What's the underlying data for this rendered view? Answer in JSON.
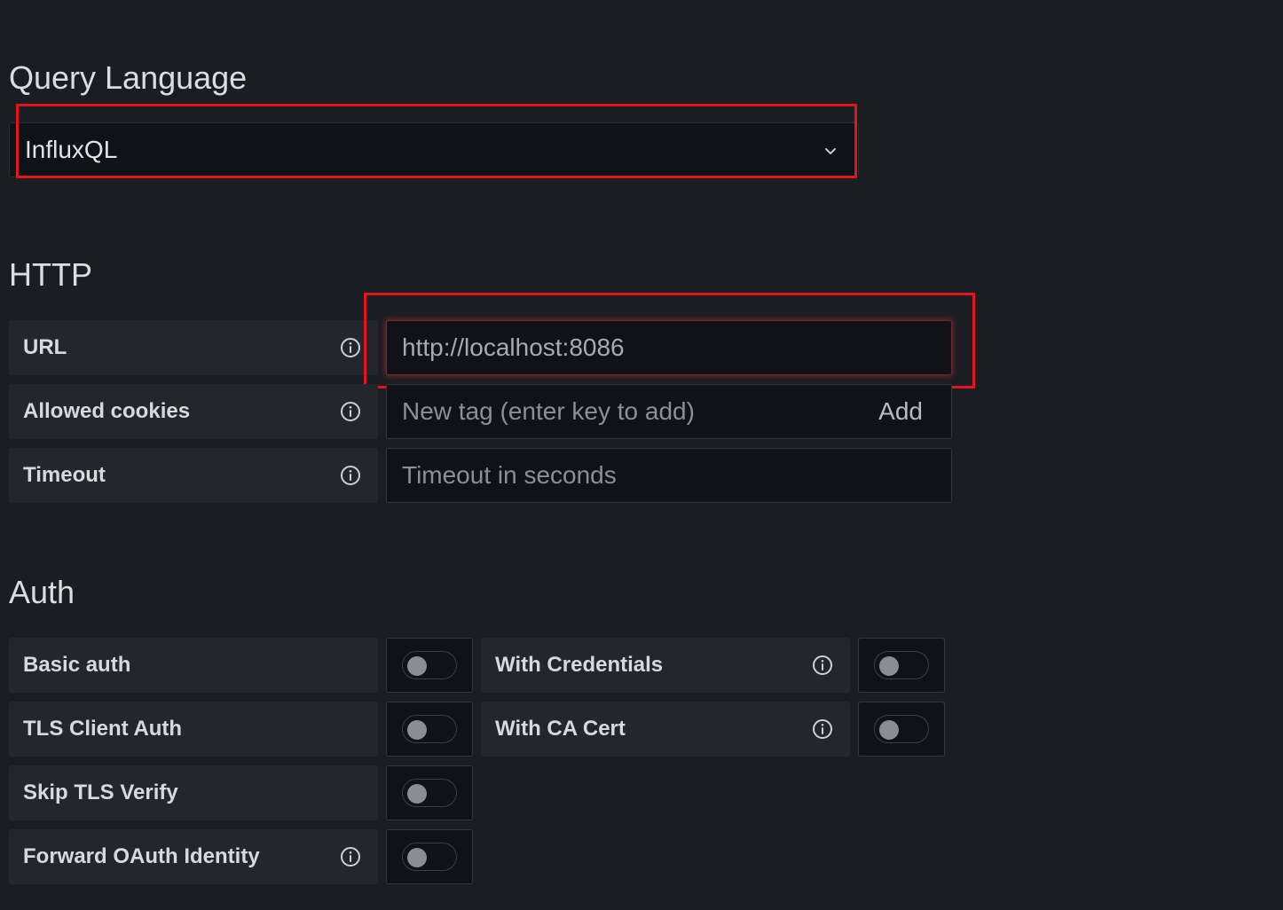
{
  "query_language": {
    "title": "Query Language",
    "selected": "InfluxQL"
  },
  "http": {
    "title": "HTTP",
    "url": {
      "label": "URL",
      "value": "http://localhost:8086"
    },
    "allowed_cookies": {
      "label": "Allowed cookies",
      "placeholder": "New tag (enter key to add)",
      "add_label": "Add"
    },
    "timeout": {
      "label": "Timeout",
      "placeholder": "Timeout in seconds"
    }
  },
  "auth": {
    "title": "Auth",
    "basic_auth": {
      "label": "Basic auth",
      "enabled": false
    },
    "with_credentials": {
      "label": "With Credentials",
      "enabled": false
    },
    "tls_client_auth": {
      "label": "TLS Client Auth",
      "enabled": false
    },
    "with_ca_cert": {
      "label": "With CA Cert",
      "enabled": false
    },
    "skip_tls_verify": {
      "label": "Skip TLS Verify",
      "enabled": false
    },
    "forward_oauth": {
      "label": "Forward OAuth Identity",
      "enabled": false
    }
  },
  "colors": {
    "background": "#1c1d22",
    "label_bg": "#24262d",
    "input_bg": "#111217",
    "highlight": "#e3141c"
  }
}
